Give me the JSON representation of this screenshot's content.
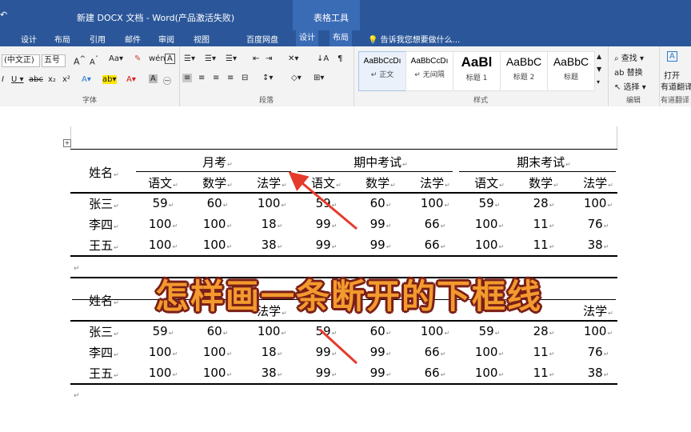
{
  "titlebar": {
    "qa": "↶",
    "title": "新建 DOCX 文档 - Word(产品激活失败)",
    "context_tab": "表格工具"
  },
  "tabs": [
    "设计",
    "布局",
    "引用",
    "邮件",
    "审阅",
    "视图",
    "百度网盘",
    "设计",
    "布局"
  ],
  "tell_me": "告诉我您想要做什么...",
  "ribbon": {
    "font": {
      "name": "(中文正)",
      "size": "五号",
      "group_label": "字体"
    },
    "paragraph": {
      "group_label": "段落"
    },
    "styles": {
      "group_label": "样式",
      "items": [
        {
          "sample": "AaBbCcDı",
          "name": "↵ 正文"
        },
        {
          "sample": "AaBbCcDı",
          "name": "↵ 无间隔"
        },
        {
          "sample": "AaBl",
          "name": "标题 1"
        },
        {
          "sample": "AaBbC",
          "name": "标题 2"
        },
        {
          "sample": "AaBbC",
          "name": "标题"
        }
      ]
    },
    "editing": {
      "find": "查找",
      "replace": "替换",
      "select": "选择",
      "group_label": "编辑"
    },
    "extra": {
      "label1": "打开",
      "label2": "有道翻译",
      "group_label": "有道翻译"
    }
  },
  "table": {
    "name_header": "姓名",
    "groups": [
      "月考",
      "期中考试",
      "期末考试"
    ],
    "subjects": [
      "语文",
      "数学",
      "法学"
    ],
    "rows": [
      {
        "name": "张三",
        "values": [
          "59",
          "60",
          "100",
          "59",
          "60",
          "100",
          "59",
          "28",
          "100"
        ]
      },
      {
        "name": "李四",
        "values": [
          "100",
          "100",
          "18",
          "99",
          "99",
          "66",
          "100",
          "11",
          "76"
        ]
      },
      {
        "name": "王五",
        "values": [
          "100",
          "100",
          "38",
          "99",
          "99",
          "66",
          "100",
          "11",
          "38"
        ]
      }
    ]
  },
  "overlay_caption": "怎样画一条断开的下框线",
  "colors": {
    "word_blue": "#2b579a",
    "caption_fill": "#f39a2e",
    "caption_outline": "#7a1f18",
    "arrow_red": "#e53b2c"
  }
}
